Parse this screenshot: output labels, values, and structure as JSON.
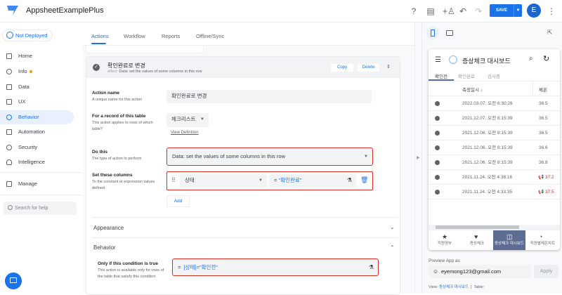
{
  "header": {
    "app_title": "AppsheetExamplePlus",
    "save_label": "SAVE",
    "avatar_letter": "E"
  },
  "sidebar": {
    "deploy_status": "Not Deployed",
    "items": [
      {
        "label": "Home"
      },
      {
        "label": "Info"
      },
      {
        "label": "Data"
      },
      {
        "label": "UX"
      },
      {
        "label": "Behavior"
      },
      {
        "label": "Automation"
      },
      {
        "label": "Security"
      },
      {
        "label": "Intelligence"
      },
      {
        "label": "Manage"
      }
    ],
    "search_placeholder": "Search for help"
  },
  "tabs": [
    "Actions",
    "Workflow",
    "Reports",
    "Offline/Sync"
  ],
  "action": {
    "title": "확인완료로 변경",
    "effect_label": "effect:",
    "effect": "Data: set the values of some columns in this row",
    "copy": "Copy",
    "delete": "Delete",
    "name_label": "Action name",
    "name_help": "A unique name for this action",
    "name_value": "확인완료로 변경",
    "table_label": "For a record of this table",
    "table_help": "This action applies to rows of which table?",
    "table_value": "체크리스트",
    "view_definition": "View Definition",
    "do_label": "Do this",
    "do_help": "The type of action to perform",
    "do_value": "Data: set the values of some columns in this row",
    "set_label": "Set these columns",
    "set_help": "To the constant or expression values defined",
    "set_column": "상태",
    "set_eq": "=",
    "set_expr": "\"확인완료\"",
    "add": "Add",
    "appearance": "Appearance",
    "behavior": "Behavior",
    "cond_label": "Only if this condition is true",
    "cond_help": "This action is available only for rows of the table that satisfy this condition",
    "cond_eq": "=",
    "cond_expr": "[상태]=\"확인전\""
  },
  "preview": {
    "title": "증상체크 대시보드",
    "tabs": [
      "확인전",
      "확인완료",
      "검사중"
    ],
    "col_date": "측정일시 ↓",
    "col_temp": "체온",
    "rows": [
      {
        "date": "2022.03.07. 오전 6:30:26",
        "temp": "36.5",
        "alert": false
      },
      {
        "date": "2021.12.07. 오전 8:15:39",
        "temp": "36.5",
        "alert": false
      },
      {
        "date": "2021.12.06. 오전 8:15:39",
        "temp": "36.5",
        "alert": false
      },
      {
        "date": "2021.12.06. 오전 8:15:39",
        "temp": "36.6",
        "alert": false
      },
      {
        "date": "2021.12.06. 오전 8:15:39",
        "temp": "36.8",
        "alert": false
      },
      {
        "date": "2021.11.24. 오전 4:38:16",
        "temp": "37.2",
        "alert": true
      },
      {
        "date": "2021.11.24. 오전 4:33:35",
        "temp": "37.5",
        "alert": true
      }
    ],
    "bottom_nav": [
      "직원명부",
      "증상체크",
      "증상체크 대시보드",
      "직원별체온차트"
    ],
    "preview_as_label": "Preview App as",
    "preview_as_value": "eyemong123@gmail.com",
    "apply": "Apply",
    "view_label": "View:",
    "view_value": "증상체크 대시보드",
    "sep": "|",
    "table_label": "Table:"
  },
  "colors": {
    "accent": "#1a73e8",
    "alert": "#d93025",
    "nav_active": "#5c6c93"
  }
}
